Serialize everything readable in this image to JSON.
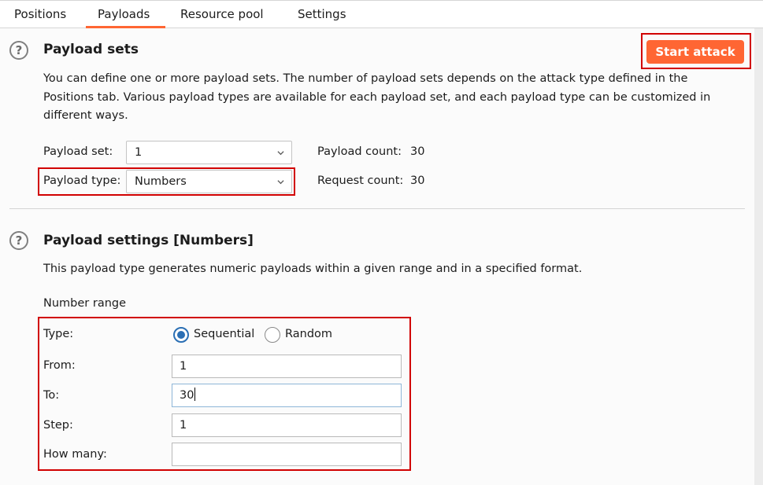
{
  "tabs": [
    {
      "label": "Positions"
    },
    {
      "label": "Payloads",
      "active": true
    },
    {
      "label": "Resource pool"
    },
    {
      "label": "Settings"
    }
  ],
  "accent_color": "#ff6633",
  "payload_sets": {
    "help_icon": "?",
    "title": "Payload sets",
    "start_attack_label": "Start attack",
    "description_lines": [
      "You can define one or more payload sets. The number of payload sets depends on the attack type defined in the",
      "Positions tab. Various payload types are available for each payload set, and each payload type can be customized in",
      "different ways."
    ],
    "payload_set_label": "Payload set:",
    "payload_set_value": "1",
    "payload_type_label": "Payload type:",
    "payload_type_value": "Numbers",
    "payload_count_label": "Payload count:",
    "payload_count_value": "30",
    "request_count_label": "Request count:",
    "request_count_value": "30"
  },
  "payload_settings": {
    "help_icon": "?",
    "title": "Payload settings [Numbers]",
    "description": "This payload type generates numeric payloads within a given range and in a specified format.",
    "number_range_label": "Number range",
    "type_label": "Type:",
    "type_options": [
      {
        "label": "Sequential",
        "selected": true
      },
      {
        "label": "Random",
        "selected": false
      }
    ],
    "from_label": "From:",
    "from_value": "1",
    "to_label": "To:",
    "to_value": "30",
    "step_label": "Step:",
    "step_value": "1",
    "how_many_label": "How many:",
    "how_many_value": ""
  }
}
